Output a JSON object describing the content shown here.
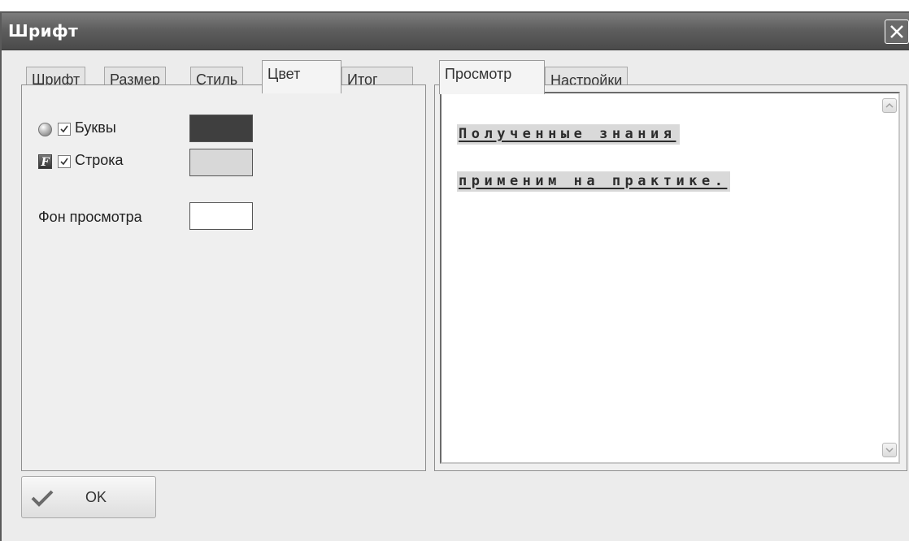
{
  "window": {
    "title": "Шрифт"
  },
  "left_tabs": [
    {
      "label": "Шрифт",
      "active": false
    },
    {
      "label": "Размер",
      "active": false
    },
    {
      "label": "Стиль",
      "active": false
    },
    {
      "label": "Цвет",
      "active": true
    },
    {
      "label": "Итог",
      "active": false
    }
  ],
  "color_panel": {
    "letters": {
      "label": "Буквы",
      "checked": true,
      "color": "#3f3f3f",
      "icon": "sphere-icon"
    },
    "line": {
      "label": "Строка",
      "checked": true,
      "color": "#d8d8d8",
      "icon": "font-f-icon"
    },
    "preview_bg": {
      "label": "Фон просмотра",
      "color": "#ffffff"
    }
  },
  "right_tabs": [
    {
      "label": "Просмотр",
      "active": true
    },
    {
      "label": "Настройки",
      "active": false
    }
  ],
  "preview": {
    "lines": [
      "Полученные знания ",
      "применим на практике."
    ]
  },
  "footer": {
    "ok_label": "OK"
  },
  "colors": {
    "titlebar": "#5e5e5e",
    "dialog_bg": "#ececec"
  }
}
